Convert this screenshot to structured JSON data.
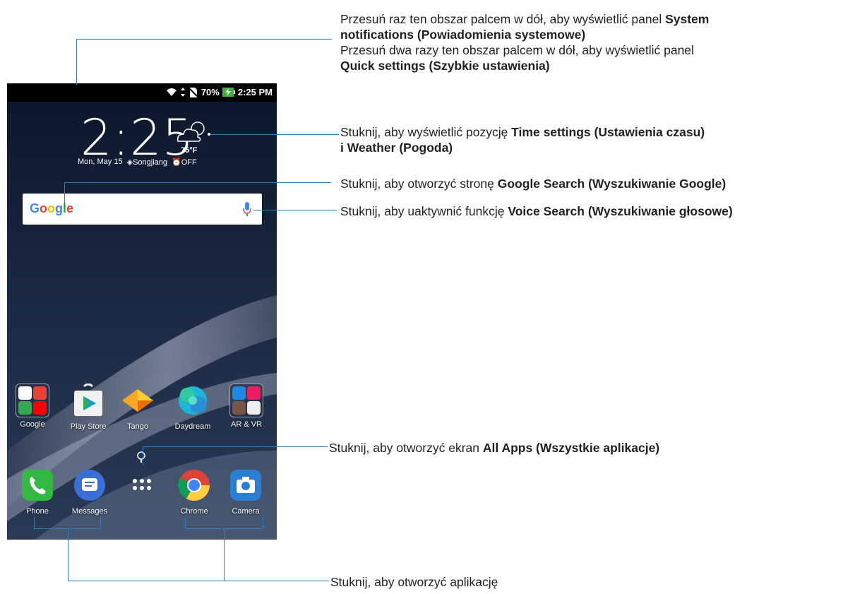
{
  "status_bar": {
    "battery": "70%",
    "time": "2:25 PM"
  },
  "clock_widget": {
    "time": "2:25",
    "temperature": "75°F",
    "date": "Mon, May 15",
    "location": "Songjiang",
    "alarm": "OFF"
  },
  "search_widget": {
    "logo": "Google"
  },
  "apps_row": [
    {
      "label": "Google"
    },
    {
      "label": "Play Store"
    },
    {
      "label": "Tango"
    },
    {
      "label": "Daydream"
    },
    {
      "label": "AR & VR"
    }
  ],
  "dock": [
    {
      "label": "Phone"
    },
    {
      "label": "Messages"
    },
    {
      "label": ""
    },
    {
      "label": "Chrome"
    },
    {
      "label": "Camera"
    }
  ],
  "annotations": {
    "status": {
      "line1_pre": "Przesuń raz ten obszar palcem w dół, aby wyświetlić panel ",
      "line1_bold": "System",
      "line2_bold": "notifications (Powiadomienia systemowe)",
      "line3": "Przesuń dwa razy ten obszar palcem w dół, aby wyświetlić panel",
      "line4_bold": "Quick settings (Szybkie ustawienia)"
    },
    "time": {
      "line1_pre": "Stuknij, aby wyświetlić pozycję ",
      "line1_bold": "Time settings (Ustawienia czasu)",
      "line2_bold": "i Weather (Pogoda)"
    },
    "google": {
      "pre": "Stuknij, aby otworzyć stronę ",
      "bold": "Google Search (Wyszukiwanie Google)"
    },
    "voice": {
      "pre": "Stuknij, aby uaktywnić funkcję ",
      "bold": "Voice Search (Wyszukiwanie głosowe)"
    },
    "all_apps": {
      "pre": "Stuknij, aby otworzyć ekran ",
      "bold": "All Apps (Wszystkie aplikacje)"
    },
    "open_app": {
      "text": "Stuknij, aby otworzyć aplikację"
    }
  },
  "colors": {
    "callout_line": "#2f7fc0",
    "text": "#231f20"
  }
}
